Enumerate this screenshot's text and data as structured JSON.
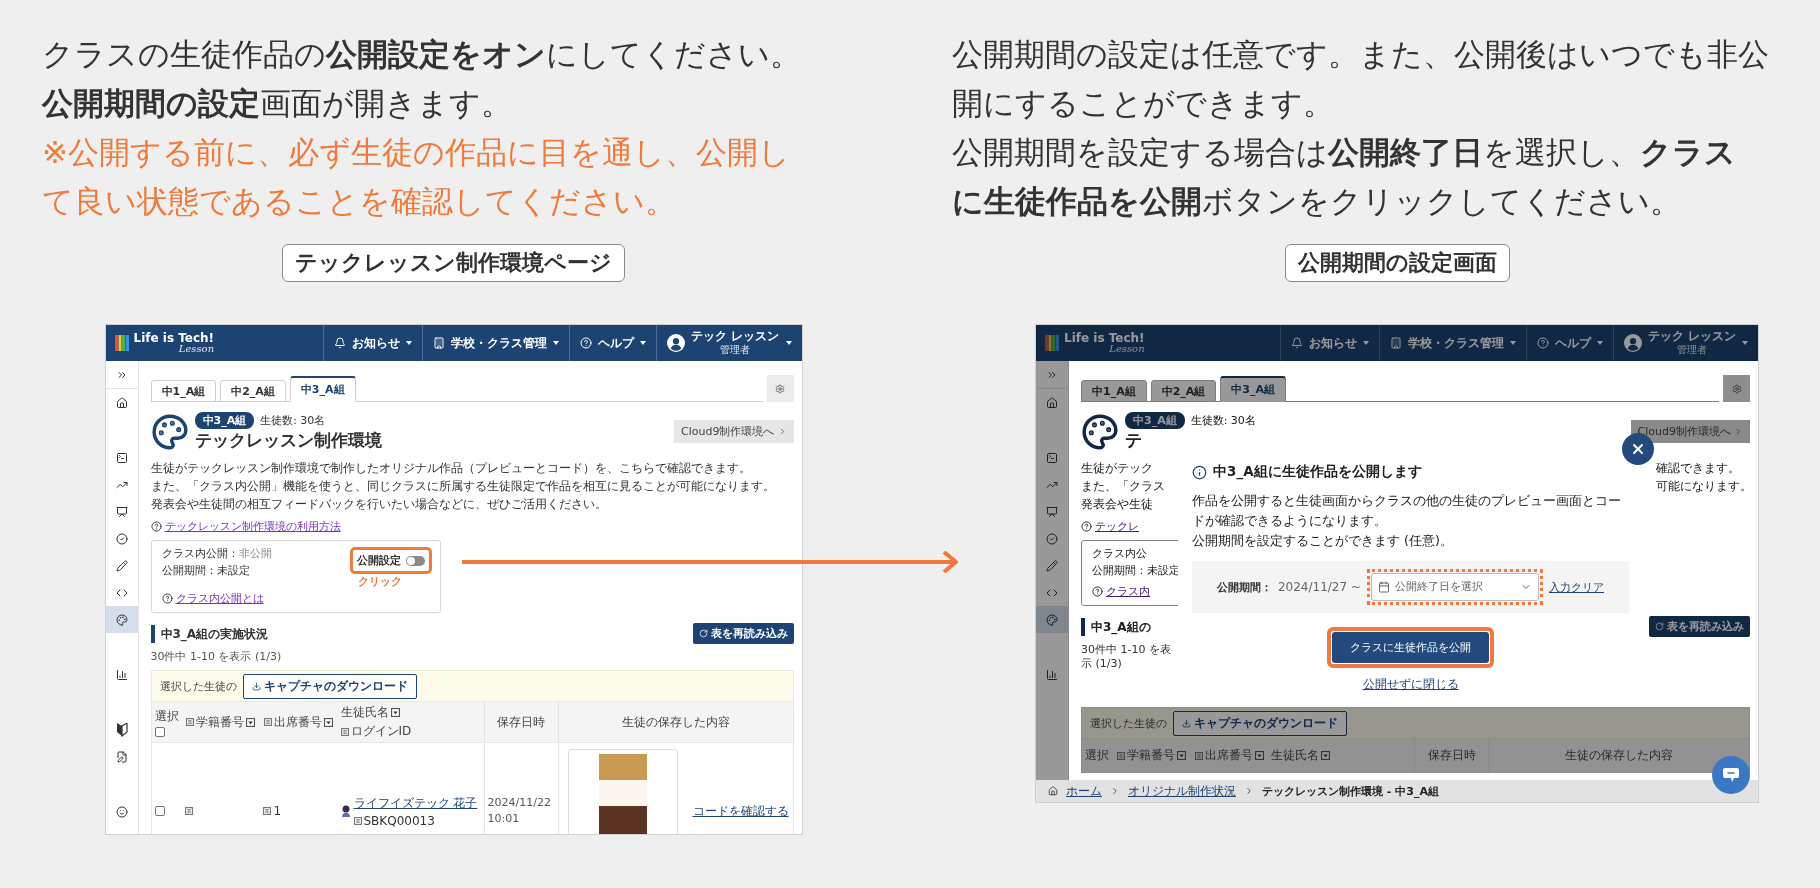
{
  "left_panel": {
    "lines": [
      {
        "text": "クラスの生徒作品の**公開設定をオン**にしてください。",
        "kind": "normal"
      },
      {
        "text": "**公開期間の設定**画面が開きます。",
        "kind": "normal"
      },
      {
        "text": "※公開する前に、必ず生徒の作品に目を通し、公開し",
        "kind": "warning"
      },
      {
        "text": "て良い状態であることを確認してください。",
        "kind": "warning"
      }
    ],
    "caption": "テックレッスン制作環境ページ"
  },
  "right_panel": {
    "lines": [
      {
        "text": "公開期間の設定は任意です。また、公開後はいつでも非公",
        "kind": "normal"
      },
      {
        "text": "開にすることができます。",
        "kind": "normal"
      },
      {
        "text": "公開期間を設定する場合は**公開終了日**を選択し、**クラス**",
        "kind": "normal"
      },
      {
        "text": "**に生徒作品を公開**ボタンをクリックしてください。",
        "kind": "normal"
      }
    ],
    "caption": "公開期間の設定画面"
  },
  "class_page": {
    "header": {
      "logo": "Life is Tech!",
      "logo_sub": "Lesson",
      "menus": [
        {
          "kind": "bell",
          "label": "お知らせ"
        },
        {
          "kind": "building",
          "label": "学校・クラス管理"
        },
        {
          "kind": "help",
          "label": "ヘルプ"
        }
      ],
      "user_name": "テック レッスン",
      "user_role": "管理者"
    },
    "sidebar": {
      "groups": [
        {
          "items": [
            {
              "kind": "expand",
              "selected": false
            }
          ]
        },
        {
          "items": [
            {
              "kind": "home",
              "selected": false
            }
          ]
        },
        {
          "items": [
            {
              "kind": "terminal",
              "selected": false
            },
            {
              "kind": "trend",
              "selected": false
            },
            {
              "kind": "presentation",
              "selected": false
            },
            {
              "kind": "check",
              "selected": false
            },
            {
              "kind": "pencil",
              "selected": false
            },
            {
              "kind": "code",
              "selected": false
            },
            {
              "kind": "palette",
              "selected": true
            }
          ]
        },
        {
          "items": [
            {
              "kind": "chart",
              "selected": false
            }
          ]
        },
        {
          "items": [
            {
              "kind": "beginner",
              "selected": false
            },
            {
              "kind": "file",
              "selected": false
            }
          ]
        },
        {
          "items": [
            {
              "kind": "smile",
              "selected": false
            }
          ]
        }
      ]
    },
    "tabs": [
      {
        "label": "中1_A組",
        "selected": false
      },
      {
        "label": "中2_A組",
        "selected": false
      },
      {
        "label": "中3_A組",
        "selected": true
      }
    ],
    "badge": "中3_A組",
    "student_count": "生徒数: 30名",
    "title": "テックレッスン制作環境",
    "cloud9_button": "Cloud9制作環境へ",
    "description": [
      "生徒がテックレッスン制作環境で制作したオリジナル作品（プレビューとコード）を、こちらで確認できます。",
      "また、「クラス内公開」機能を使うと、同じクラスに所属する生徒限定で作品を相互に見ることが可能になります。",
      "発表会や生徒間の相互フィードバックを行いたい場合などに、ぜひご活用ください。"
    ],
    "help_link": "テックレッスン制作環境の利用方法",
    "publish_card": {
      "label": "クラス内公開：",
      "status": "非公開",
      "period": "公開期間：未設定",
      "help_link": "クラス内公開とは",
      "toggle_label": "公開設定",
      "toggle_on": false,
      "hint": "クリック"
    },
    "section_title": "中3_A組の実施状況",
    "reload_button": "表を再読み込み",
    "count": "30件中 1-10 を表示 (1/3)",
    "bulk_label": "選択した生徒の",
    "bulk_button": "キャプチャのダウンロード",
    "table": {
      "select_all_checked": false,
      "columns": [
        {
          "label": "選択",
          "kind": "select"
        },
        {
          "label": "学籍番号",
          "kind": "sortable"
        },
        {
          "label": "出席番号",
          "kind": "sortable"
        },
        {
          "label": "生徒氏名",
          "kind": "name",
          "sub": "ログインID"
        },
        {
          "label": "保存日時",
          "kind": "plain"
        },
        {
          "label": "生徒の保存した内容",
          "kind": "plain"
        }
      ],
      "rows": [
        {
          "checked": false,
          "attendance": "1",
          "name": "ライフイズテック 花子",
          "login_id": "SBKQ00013",
          "saved": "2024/11/22 10:01",
          "action": "コードを確認する"
        }
      ]
    }
  },
  "dialog_page": {
    "header": {
      "logo": "Life is Tech!",
      "logo_sub": "Lesson",
      "menus": [
        {
          "kind": "bell",
          "label": "お知らせ"
        },
        {
          "kind": "building",
          "label": "学校・クラス管理"
        },
        {
          "kind": "help",
          "label": "ヘルプ"
        }
      ],
      "user_name": "テック レッスン",
      "user_role": "管理者"
    },
    "sidebar": {
      "groups": [
        {
          "items": [
            {
              "kind": "expand",
              "selected": false
            }
          ]
        },
        {
          "items": [
            {
              "kind": "home",
              "selected": false
            }
          ]
        },
        {
          "items": [
            {
              "kind": "terminal",
              "selected": false
            },
            {
              "kind": "trend",
              "selected": false
            },
            {
              "kind": "presentation",
              "selected": false
            },
            {
              "kind": "check",
              "selected": false
            },
            {
              "kind": "pencil",
              "selected": false
            },
            {
              "kind": "code",
              "selected": false
            },
            {
              "kind": "palette",
              "selected": true
            }
          ]
        },
        {
          "items": [
            {
              "kind": "chart",
              "selected": false
            }
          ]
        }
      ]
    },
    "tabs": [
      {
        "label": "中1_A組",
        "selected": false
      },
      {
        "label": "中2_A組",
        "selected": false
      },
      {
        "label": "中3_A組",
        "selected": true
      }
    ],
    "badge": "中3_A組",
    "student_count": "生徒数: 30名",
    "title": "テ",
    "cloud9_button": "Cloud9制作環境へ",
    "description": [
      {
        "left": "生徒がテック",
        "right": "確認できます。"
      },
      {
        "left": "また、「クラス",
        "right": "可能になります。"
      },
      {
        "left": "発表会や生徒"
      }
    ],
    "help_link": "テックレ",
    "card": {
      "label": "クラス内公",
      "period": "公開期間：未設定",
      "help_link": "クラス内"
    },
    "section_title": "中3_A組の",
    "reload_button": "表を再読み込み",
    "count": "30件中 1-10 を表示 (1/3)",
    "bulk_label": "選択した生徒の",
    "bulk_button": "キャプチャのダウンロード",
    "table": {
      "columns": [
        {
          "label": "選択",
          "kind": "select"
        },
        {
          "label": "学籍番号",
          "kind": "sortable"
        },
        {
          "label": "出席番号",
          "kind": "sortable"
        },
        {
          "label": "生徒氏名",
          "kind": "name"
        },
        {
          "label": "保存日時",
          "kind": "plain"
        },
        {
          "label": "生徒の保存した内容",
          "kind": "plain"
        }
      ]
    },
    "dialog": {
      "title": "中3_A組に生徒作品を公開します",
      "body": [
        "作品を公開すると生徒画面からクラスの他の生徒のプレビュー画面とコードが確認できるようになります。",
        "公開期間を設定することができます (任意)。"
      ],
      "period_label": "公開期間：",
      "start_date": "2024/11/27 ~",
      "end_placeholder": "公開終了日を選択",
      "clear_link": "入力クリア",
      "publish_button": "クラスに生徒作品を公開",
      "close_link": "公開せずに閉じる"
    },
    "breadcrumb": [
      {
        "kind": "home",
        "label": "ホーム"
      },
      {
        "kind": "link",
        "label": "オリジナル制作状況"
      },
      {
        "kind": "current",
        "label": "テックレッスン制作環境 - 中3_A組"
      }
    ]
  }
}
